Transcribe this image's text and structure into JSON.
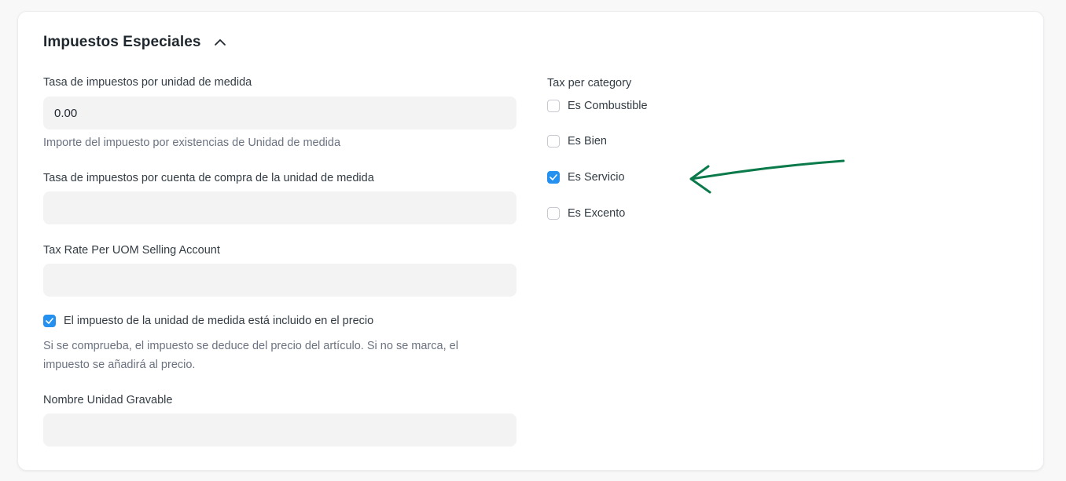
{
  "section": {
    "title": "Impuestos Especiales"
  },
  "left": {
    "rate_label": "Tasa de impuestos por unidad de medida",
    "rate_value": "0.00",
    "rate_help": "Importe del impuesto por existencias de Unidad de medida",
    "purchase_label": "Tasa de impuestos por cuenta de compra de la unidad de medida",
    "purchase_value": "",
    "selling_label": "Tax Rate Per UOM Selling Account",
    "selling_value": "",
    "included_label": "El impuesto de la unidad de medida está incluido en el precio",
    "included_checked": true,
    "included_help_line1": "Si se comprueba, el impuesto se deduce del precio del artículo. Si no se marca, el",
    "included_help_line2": "impuesto se añadirá al precio.",
    "taxable_unit_label": "Nombre Unidad Gravable",
    "taxable_unit_value": ""
  },
  "right": {
    "category_label": "Tax per category",
    "options": [
      {
        "label": "Es Combustible",
        "checked": false
      },
      {
        "label": "Es Bien",
        "checked": false
      },
      {
        "label": "Es Servicio",
        "checked": true
      },
      {
        "label": "Es Excento",
        "checked": false
      }
    ]
  },
  "colors": {
    "checkbox_checked": "#2490ef",
    "annotation_arrow": "#0b7a4b"
  }
}
